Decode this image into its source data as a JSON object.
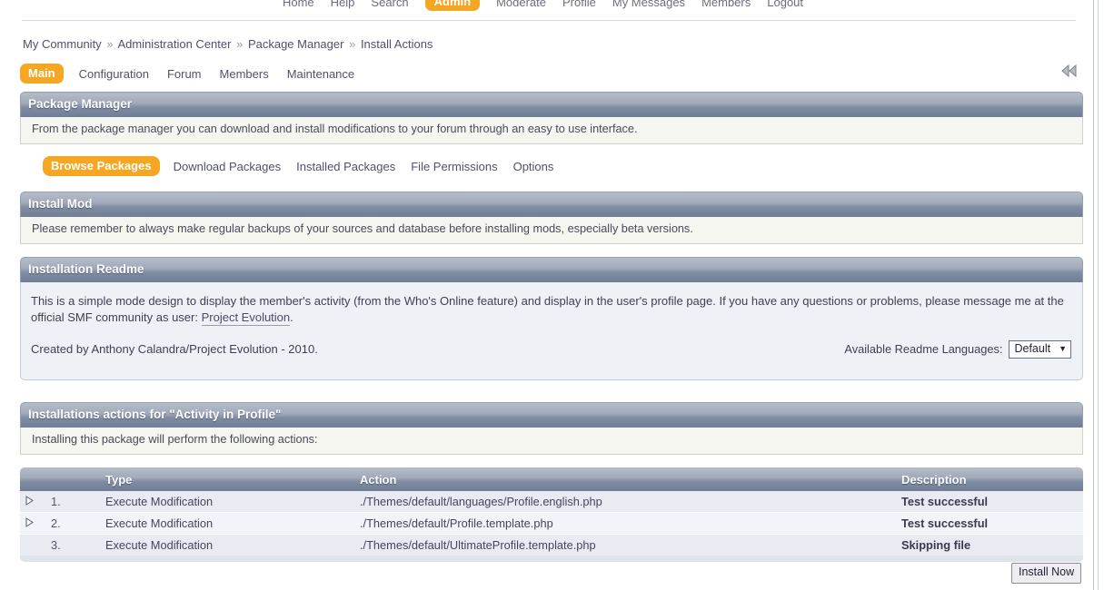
{
  "topnav": {
    "items": [
      {
        "label": "Home",
        "active": false
      },
      {
        "label": "Help",
        "active": false
      },
      {
        "label": "Search",
        "active": false
      },
      {
        "label": "Admin",
        "active": true
      },
      {
        "label": "Moderate",
        "active": false
      },
      {
        "label": "Profile",
        "active": false
      },
      {
        "label": "My Messages",
        "active": false
      },
      {
        "label": "Members",
        "active": false
      },
      {
        "label": "Logout",
        "active": false
      }
    ]
  },
  "breadcrumb": {
    "items": [
      "My Community",
      "Administration Center",
      "Package Manager",
      "Install Actions"
    ],
    "separator": "»"
  },
  "admin_tabs": {
    "items": [
      {
        "label": "Main",
        "active": true
      },
      {
        "label": "Configuration",
        "active": false
      },
      {
        "label": "Forum",
        "active": false
      },
      {
        "label": "Members",
        "active": false
      },
      {
        "label": "Maintenance",
        "active": false
      }
    ],
    "collapse_icon": "double-left-arrow-icon"
  },
  "package_manager": {
    "title": "Package Manager",
    "description": "From the package manager you can download and install modifications to your forum through an easy to use interface.",
    "submenu": [
      {
        "label": "Browse Packages",
        "active": true
      },
      {
        "label": "Download Packages",
        "active": false
      },
      {
        "label": "Installed Packages",
        "active": false
      },
      {
        "label": "File Permissions",
        "active": false
      },
      {
        "label": "Options",
        "active": false
      }
    ]
  },
  "install_mod": {
    "title": "Install Mod",
    "description": "Please remember to always make regular backups of your sources and database before installing mods, especially beta versions."
  },
  "readme": {
    "title": "Installation Readme",
    "paragraph1_before_link": "This is a simple mode design to display the member's activity (from the Who's Online feature) and display in the user's profile page. If you have any questions or problems, please message me at the official SMF community as user: ",
    "link_text": "Project Evolution",
    "paragraph1_after_link": ".",
    "paragraph2": "Created by Anthony Calandra/Project Evolution - 2010.",
    "language_label": "Available Readme Languages:",
    "language_value": "Default",
    "language_options": [
      "Default"
    ]
  },
  "install_actions": {
    "title": "Installations actions for \"Activity in Profile\"",
    "description": "Installing this package will perform the following actions:",
    "columns": [
      "",
      "",
      "Type",
      "Action",
      "Description"
    ],
    "rows": [
      {
        "expand": true,
        "expand_icon": "triangle-right-icon",
        "num": "1.",
        "type": "Execute Modification",
        "action": "./Themes/default/languages/Profile.english.php",
        "description": "Test successful"
      },
      {
        "expand": true,
        "expand_icon": "triangle-right-icon",
        "num": "2.",
        "type": "Execute Modification",
        "action": "./Themes/default/Profile.template.php",
        "description": "Test successful"
      },
      {
        "expand": false,
        "expand_icon": "",
        "num": "3.",
        "type": "Execute Modification",
        "action": "./Themes/default/UltimateProfile.template.php",
        "description": "Skipping file"
      }
    ],
    "install_button": "Install Now"
  },
  "colors": {
    "accent_orange": "#f5a623",
    "panel_header_dark": "#6f7d95",
    "info_bg": "#f4f6ef",
    "window_bg": "#eef1f6"
  }
}
